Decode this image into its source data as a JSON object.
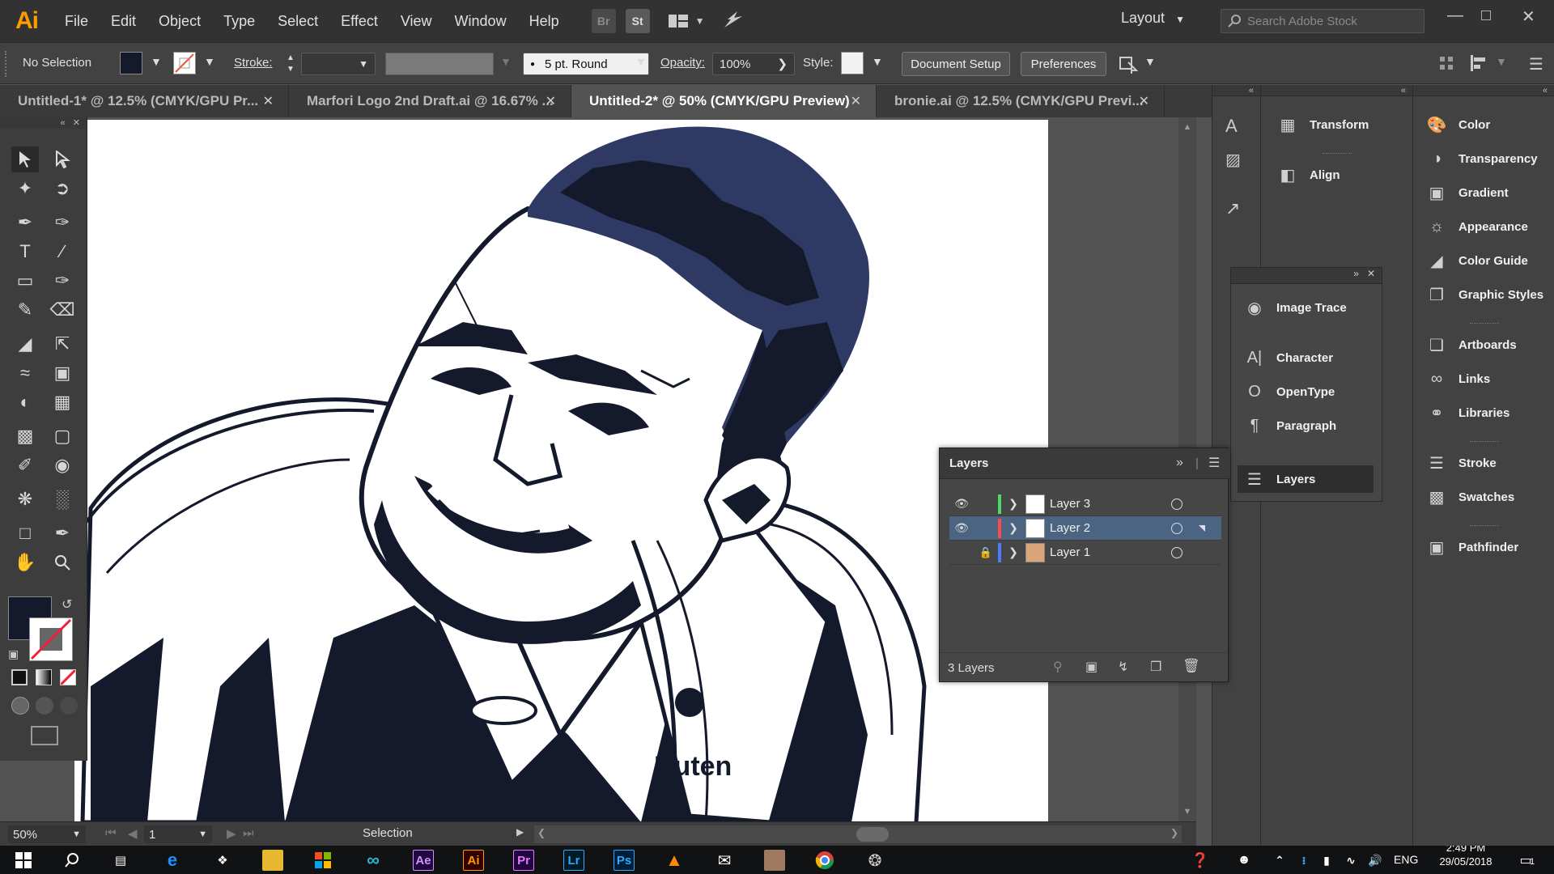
{
  "app": {
    "logo": "Ai"
  },
  "menu": [
    "File",
    "Edit",
    "Object",
    "Type",
    "Select",
    "Effect",
    "View",
    "Window",
    "Help"
  ],
  "bridge": {
    "br": "Br",
    "st": "St"
  },
  "workspace": "Layout",
  "search": {
    "placeholder": "Search Adobe Stock"
  },
  "control": {
    "selection": "No Selection",
    "stroke_label": "Stroke:",
    "brush": "5 pt. Round",
    "opacity_label": "Opacity:",
    "opacity_value": "100%",
    "style_label": "Style:",
    "doc_setup": "Document Setup",
    "preferences": "Preferences",
    "fill_color": "#141a2b"
  },
  "tabs": [
    {
      "label": "Untitled-1* @ 12.5% (CMYK/GPU Pr..."
    },
    {
      "label": "Marfori Logo 2nd Draft.ai @ 16.67% ..."
    },
    {
      "label": "Untitled-2* @ 50% (CMYK/GPU Preview)"
    },
    {
      "label": "bronie.ai @ 12.5% (CMYK/GPU Previ..."
    }
  ],
  "artwork": {
    "ink": "#141a2b",
    "hair": "#2e3a63",
    "shirt_text": "Kuten"
  },
  "status": {
    "zoom": "50%",
    "artboard": "1",
    "tool": "Selection"
  },
  "dock2": {
    "transform": "Transform",
    "align": "Align"
  },
  "typepanel": {
    "image_trace": "Image Trace",
    "character": "Character",
    "opentype": "OpenType",
    "paragraph": "Paragraph",
    "layers": "Layers"
  },
  "dock3": {
    "color": "Color",
    "transparency": "Transparency",
    "gradient": "Gradient",
    "appearance": "Appearance",
    "color_guide": "Color Guide",
    "graphic_styles": "Graphic Styles",
    "artboards": "Artboards",
    "links": "Links",
    "libraries": "Libraries",
    "stroke": "Stroke",
    "swatches": "Swatches",
    "pathfinder": "Pathfinder"
  },
  "layers": {
    "title": "Layers",
    "count": "3 Layers",
    "rows": [
      {
        "name": "Layer 3",
        "color": "#4cd964"
      },
      {
        "name": "Layer 2",
        "color": "#ff4a4a"
      },
      {
        "name": "Layer 1",
        "color": "#4a7cff"
      }
    ]
  },
  "taskbar": {
    "ae": "Ae",
    "ai": "Ai",
    "pr": "Pr",
    "lr": "Lr",
    "ps": "Ps",
    "lang": "ENG",
    "time": "2:49 PM",
    "date": "29/05/2018",
    "notif": "1"
  }
}
